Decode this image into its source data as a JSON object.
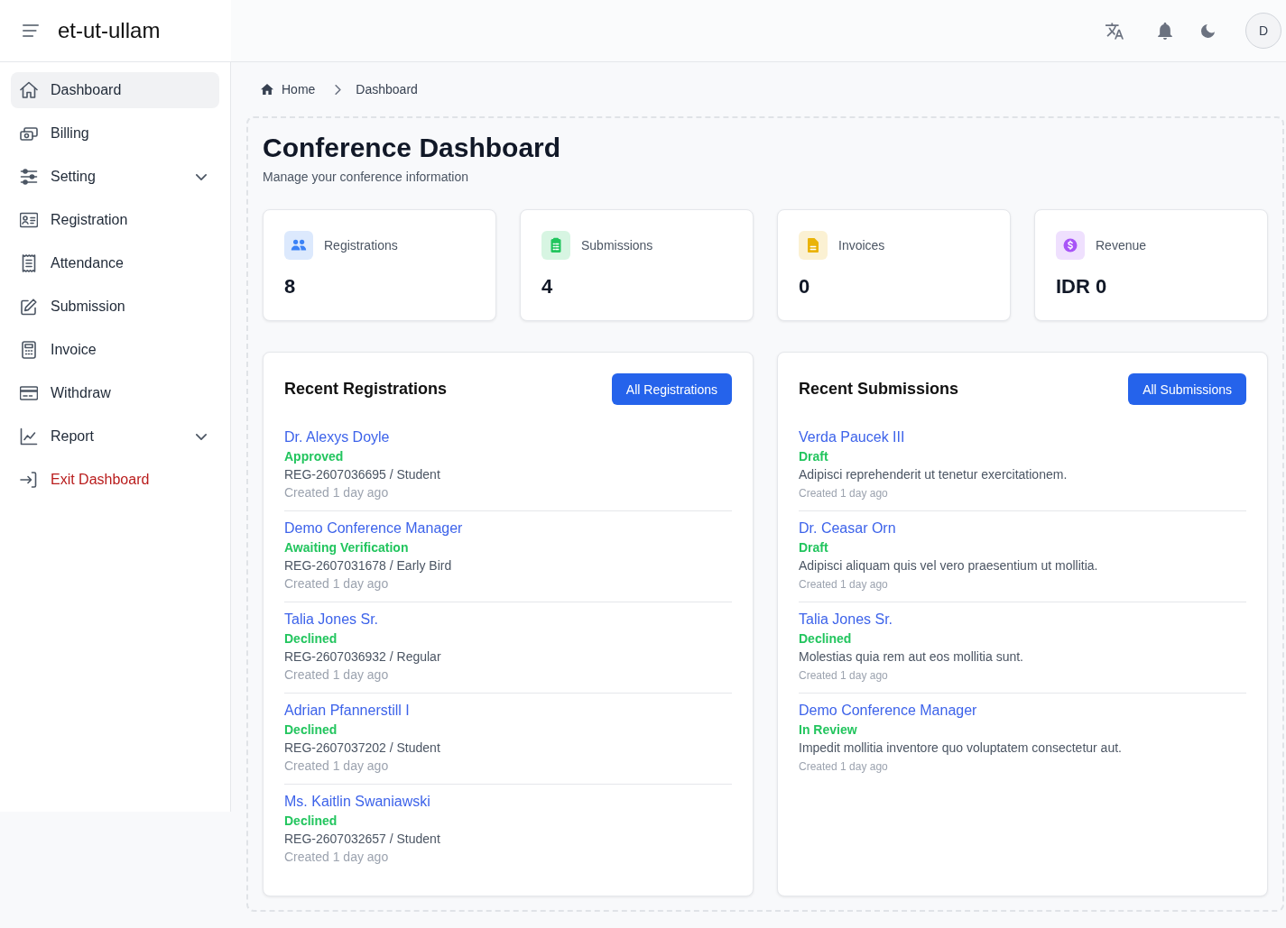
{
  "header": {
    "app_name": "et-ut-ullam",
    "avatar_initial": "D"
  },
  "sidebar": {
    "items": [
      {
        "label": "Dashboard",
        "kind": "link",
        "selected": true
      },
      {
        "label": "Billing",
        "kind": "link",
        "selected": false
      },
      {
        "label": "Setting",
        "kind": "group",
        "selected": false,
        "expanded": false
      },
      {
        "label": "Registration",
        "kind": "link",
        "selected": false
      },
      {
        "label": "Attendance",
        "kind": "link",
        "selected": false
      },
      {
        "label": "Submission",
        "kind": "link",
        "selected": false
      },
      {
        "label": "Invoice",
        "kind": "link",
        "selected": false
      },
      {
        "label": "Withdraw",
        "kind": "link",
        "selected": false
      },
      {
        "label": "Report",
        "kind": "group",
        "selected": false,
        "expanded": false
      },
      {
        "label": "Exit Dashboard",
        "kind": "exit",
        "selected": false
      }
    ]
  },
  "breadcrumb": [
    {
      "label": "Home",
      "kind": "home"
    },
    {
      "label": "Dashboard",
      "kind": "current"
    }
  ],
  "page": {
    "title": "Conference Dashboard",
    "subtitle": "Manage your conference information"
  },
  "stats": [
    {
      "label": "Registrations",
      "value": "8",
      "color": "#3b82f6"
    },
    {
      "label": "Submissions",
      "value": "4",
      "color": "#22c55e"
    },
    {
      "label": "Invoices",
      "value": "0",
      "color": "#eab308"
    },
    {
      "label": "Revenue",
      "value": "IDR 0",
      "color": "#a855f7"
    }
  ],
  "recent_registrations": {
    "title": "Recent Registrations",
    "button": "All Registrations",
    "items": [
      {
        "name": "Dr. Alexys Doyle",
        "status": "Approved",
        "reference": "REG-2607036695 / Student",
        "created": "Created 1 day ago"
      },
      {
        "name": "Demo Conference Manager",
        "status": "Awaiting Verification",
        "reference": "REG-2607031678 / Early Bird",
        "created": "Created 1 day ago"
      },
      {
        "name": "Talia Jones Sr.",
        "status": "Declined",
        "reference": "REG-2607036932 / Regular",
        "created": "Created 1 day ago"
      },
      {
        "name": "Adrian Pfannerstill I",
        "status": "Declined",
        "reference": "REG-2607037202 / Student",
        "created": "Created 1 day ago"
      },
      {
        "name": "Ms. Kaitlin Swaniawski",
        "status": "Declined",
        "reference": "REG-2607032657 / Student",
        "created": "Created 1 day ago"
      }
    ]
  },
  "recent_submissions": {
    "title": "Recent Submissions",
    "button": "All Submissions",
    "items": [
      {
        "name": "Verda Paucek III",
        "status": "Draft",
        "description": "Adipisci reprehenderit ut tenetur exercitationem.",
        "created": "Created 1 day ago"
      },
      {
        "name": "Dr. Ceasar Orn",
        "status": "Draft",
        "description": "Adipisci aliquam quis vel vero praesentium ut mollitia.",
        "created": "Created 1 day ago"
      },
      {
        "name": "Talia Jones Sr.",
        "status": "Declined",
        "description": "Molestias quia rem aut eos mollitia sunt.",
        "created": "Created 1 day ago"
      },
      {
        "name": "Demo Conference Manager",
        "status": "In Review",
        "description": "Impedit mollitia inventore quo voluptatem consectetur aut.",
        "created": "Created 1 day ago"
      }
    ]
  }
}
